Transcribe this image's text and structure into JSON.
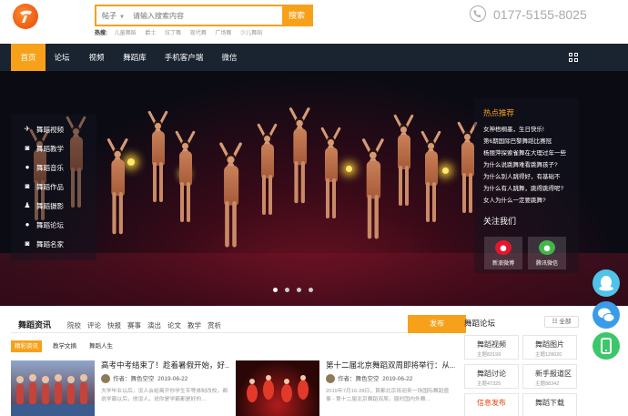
{
  "header": {
    "search_category": "帖子",
    "search_placeholder": "请输入搜索内容",
    "search_button": "搜索",
    "hot_label": "热搜:",
    "hot_words": [
      "儿童舞蹈",
      "爵士",
      "拉丁舞",
      "现代舞",
      "广场舞",
      "少儿舞蹈"
    ],
    "phone": "0177-5155-8025"
  },
  "nav": {
    "items": [
      "首页",
      "论坛",
      "视频",
      "舞蹈库",
      "手机客户端",
      "微信"
    ]
  },
  "banner": {
    "side_menu": [
      {
        "label": "舞蹈视频",
        "icon": "plane-icon"
      },
      {
        "label": "舞蹈教学",
        "icon": "camera-icon"
      },
      {
        "label": "舞蹈音乐",
        "icon": "globe-icon"
      },
      {
        "label": "舞蹈作品",
        "icon": "camera-icon"
      },
      {
        "label": "舞蹈摄影",
        "icon": "users-icon"
      },
      {
        "label": "舞蹈论坛",
        "icon": "globe-icon"
      },
      {
        "label": "舞蹈名家",
        "icon": "camera-icon"
      }
    ],
    "hot_title": "热点推荐",
    "hot_items": [
      "女神梧桐墨，生日快乐!",
      "第6期国际巴黎舞蹈比赛冠",
      "杨丽萍探索雀舞在大理过年一些",
      "为什么说跳舞难看跳舞孩子?",
      "为什么别人跳得好，有基础不",
      "为什么有人跳舞，跳得跳得呢?",
      "女人为什么一定要跳舞?"
    ],
    "follow_title": "关注我们",
    "follow_items": [
      {
        "label": "新浪微博",
        "icon": "weibo-icon"
      },
      {
        "label": "腾讯微信",
        "icon": "wechat-icon"
      }
    ]
  },
  "news": {
    "title": "舞蹈资讯",
    "tabs": [
      "院校",
      "评论",
      "快报",
      "赛事",
      "演出",
      "论文",
      "教学",
      "赏析"
    ],
    "publish": "发布",
    "subtabs": [
      "精彩资讯",
      "教学文摘",
      "舞蹈人生"
    ],
    "articles": [
      {
        "title": "高考中考结束了！趁着暑假开始，好...",
        "author": "作者：舞色空空",
        "date": "2019-06-22",
        "desc": "大学毕业以后，没人会给离开你学生平等体制改校，都说学霸以后，他没人，说你是学霸都是好的…"
      },
      {
        "title": "第十二届北京舞蹈双周即将举行：从...",
        "author": "作者：舞色空空",
        "date": "2019-06-22",
        "desc": "2019年7月16-28日，首都北京将迎来一场国际舞蹈盛事 - 第十二届北京舞蹈双周，届时国内外舞…"
      }
    ]
  },
  "forum": {
    "title": "舞蹈论坛",
    "all_button": "全部",
    "boards": [
      {
        "name": "舞蹈视频",
        "count": "主题83199",
        "highlight": false
      },
      {
        "name": "舞蹈图片",
        "count": "主题128020",
        "highlight": false
      },
      {
        "name": "舞蹈讨论",
        "count": "主题47325",
        "highlight": false
      },
      {
        "name": "新手报道区",
        "count": "主题88342",
        "highlight": false
      },
      {
        "name": "信息发布",
        "count": "",
        "highlight": true
      },
      {
        "name": "舞蹈下载",
        "count": "",
        "highlight": false
      }
    ]
  },
  "colors": {
    "accent": "#f7a11a",
    "nav_bg": "#1a2431",
    "float_1": "#4fc3e8",
    "float_2": "#3a9be8",
    "float_3": "#3cc76a"
  },
  "float_buttons": [
    "qq-icon",
    "wechat-icon",
    "mobile-icon"
  ],
  "carousel_dots": 4
}
